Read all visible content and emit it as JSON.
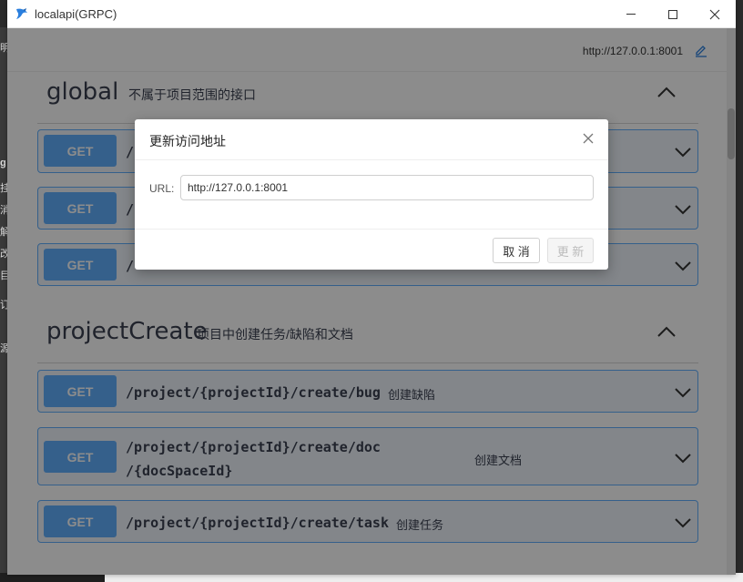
{
  "window": {
    "title": "localapi(GRPC)",
    "accent": "#61affe"
  },
  "server": {
    "url": "http://127.0.0.1:8001"
  },
  "desktop_fragments": [
    "明",
    "g",
    "挂",
    "消",
    "解",
    "改",
    "目",
    "订",
    "源"
  ],
  "sections": [
    {
      "name": "global",
      "description": "不属于项目范围的接口",
      "operations": [
        {
          "method": "GET",
          "path": "/",
          "description": ""
        },
        {
          "method": "GET",
          "path": "/",
          "description": ""
        },
        {
          "method": "GET",
          "path": "/",
          "description": ""
        }
      ]
    },
    {
      "name": "projectCreate",
      "description": "项目中创建任务/缺陷和文档",
      "operations": [
        {
          "method": "GET",
          "path": "/project/{projectId}/create/bug",
          "description": "创建缺陷"
        },
        {
          "method": "GET",
          "path": "/project/{projectId}/create/doc",
          "path_line2": "/{docSpaceId}",
          "description": "创建文档"
        },
        {
          "method": "GET",
          "path": "/project/{projectId}/create/task",
          "description": "创建任务"
        }
      ]
    }
  ],
  "modal": {
    "title": "更新访问地址",
    "url_label": "URL:",
    "url_value": "http://127.0.0.1:8001",
    "cancel_label": "取 消",
    "update_label": "更 新"
  }
}
